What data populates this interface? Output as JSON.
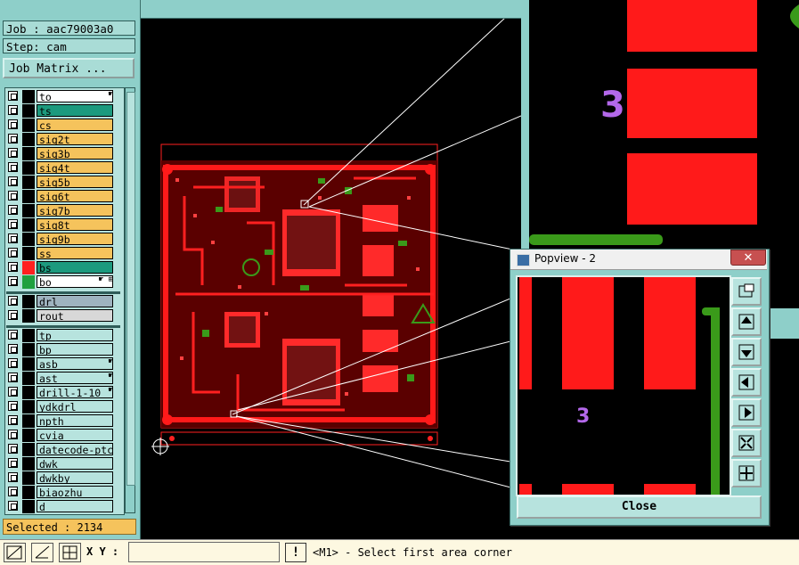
{
  "left_panel": {
    "job_label": "Job : aac79003a0",
    "step_label": "Step: cam",
    "job_matrix_button": "Job Matrix ...",
    "layers_group1": [
      {
        "name": "to",
        "color": "#ffffff",
        "swatch": "#000000",
        "tag": "☛"
      },
      {
        "name": "ts",
        "color": "#1c9a7e",
        "swatch": "#000000",
        "tag": ""
      },
      {
        "name": "cs",
        "color": "#f5c35c",
        "swatch": "#000000",
        "tag": ""
      },
      {
        "name": "sig2t",
        "color": "#f5c35c",
        "swatch": "#000000",
        "tag": ""
      },
      {
        "name": "sig3b",
        "color": "#f5c35c",
        "swatch": "#000000",
        "tag": ""
      },
      {
        "name": "sig4t",
        "color": "#f5c35c",
        "swatch": "#000000",
        "tag": ""
      },
      {
        "name": "sig5b",
        "color": "#f5c35c",
        "swatch": "#000000",
        "tag": ""
      },
      {
        "name": "sig6t",
        "color": "#f5c35c",
        "swatch": "#000000",
        "tag": ""
      },
      {
        "name": "sig7b",
        "color": "#f5c35c",
        "swatch": "#000000",
        "tag": ""
      },
      {
        "name": "sig8t",
        "color": "#f5c35c",
        "swatch": "#000000",
        "tag": ""
      },
      {
        "name": "sig9b",
        "color": "#f5c35c",
        "swatch": "#000000",
        "tag": ""
      },
      {
        "name": "ss",
        "color": "#f5c35c",
        "swatch": "#000000",
        "tag": ""
      },
      {
        "name": "bs",
        "color": "#1c9a7e",
        "swatch": "#ff2020",
        "tag": ""
      },
      {
        "name": "bo",
        "color": "#ffffff",
        "swatch": "#20a040",
        "tag": "☛ ⊞"
      }
    ],
    "layers_group2": [
      {
        "name": "drl",
        "color": "#9fb3bf",
        "swatch": "#000000",
        "tag": ""
      },
      {
        "name": "rout",
        "color": "#d8d8d8",
        "swatch": "#000000",
        "tag": ""
      }
    ],
    "layers_group3": [
      {
        "name": "tp",
        "color": "#b7e3de",
        "swatch": "#000000",
        "tag": ""
      },
      {
        "name": "bp",
        "color": "#b7e3de",
        "swatch": "#000000",
        "tag": ""
      },
      {
        "name": "asb",
        "color": "#b7e3de",
        "swatch": "#000000",
        "tag": "☛"
      },
      {
        "name": "ast",
        "color": "#b7e3de",
        "swatch": "#000000",
        "tag": "☛"
      },
      {
        "name": "drill-1-10",
        "color": "#b7e3de",
        "swatch": "#000000",
        "tag": "☛"
      },
      {
        "name": "ydkdrl",
        "color": "#b7e3de",
        "swatch": "#000000",
        "tag": ""
      },
      {
        "name": "npth",
        "color": "#b7e3de",
        "swatch": "#000000",
        "tag": ""
      },
      {
        "name": "cvia",
        "color": "#b7e3de",
        "swatch": "#000000",
        "tag": ""
      },
      {
        "name": "datecode-ptc",
        "color": "#b7e3de",
        "swatch": "#000000",
        "tag": ""
      },
      {
        "name": "dwk",
        "color": "#b7e3de",
        "swatch": "#000000",
        "tag": ""
      },
      {
        "name": "dwkby",
        "color": "#b7e3de",
        "swatch": "#000000",
        "tag": ""
      },
      {
        "name": "biaozhu",
        "color": "#b7e3de",
        "swatch": "#000000",
        "tag": ""
      },
      {
        "name": "d",
        "color": "#b7e3de",
        "swatch": "#000000",
        "tag": ""
      }
    ],
    "selected_label": "Selected : 2134"
  },
  "bottom_bar": {
    "xy_label": "X Y :",
    "xy_value": "",
    "alert_label": "!",
    "status": "<M1> - Select first area corner"
  },
  "popview": {
    "title": "Popview - 2",
    "close_x": "✕",
    "close_button": "Close"
  },
  "colors": {
    "panel": "#8ecfc9",
    "copper": "#ff1a1a",
    "green": "#3a9a1a",
    "purple": "#b368ea"
  }
}
